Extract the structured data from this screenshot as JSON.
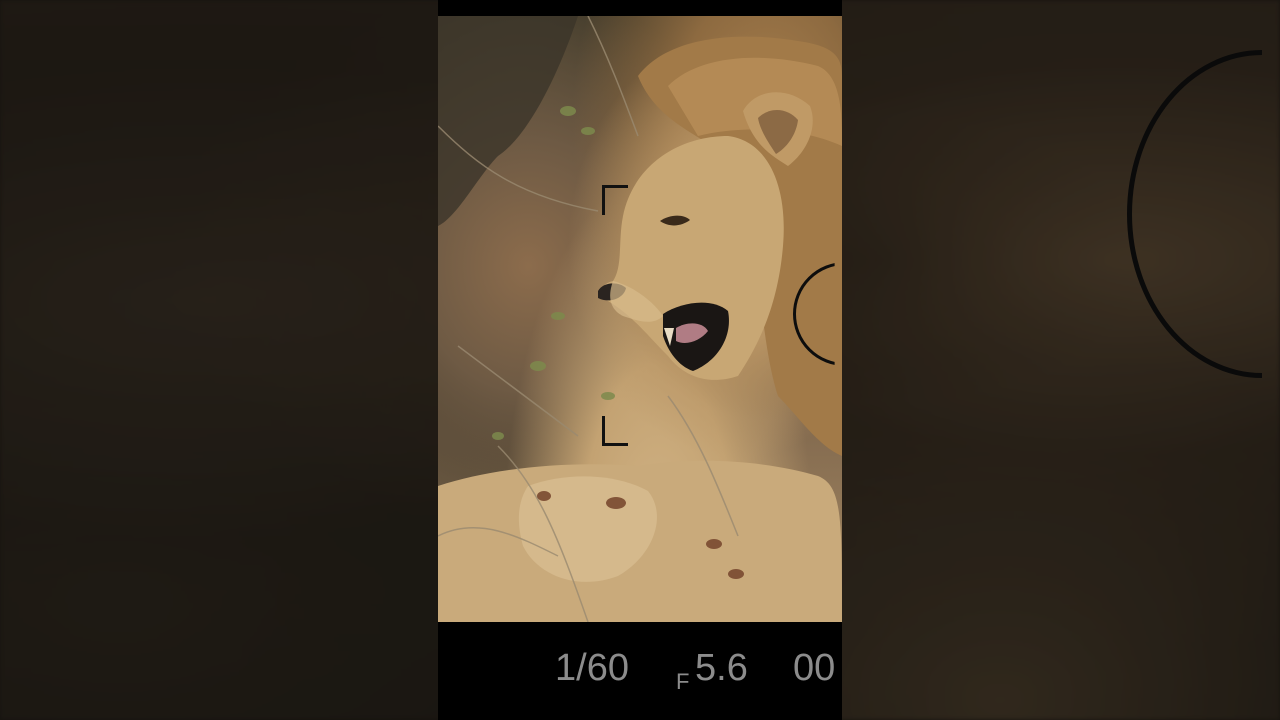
{
  "viewfinder": {
    "shutter_speed": "1/60",
    "aperture_prefix": "F",
    "aperture_value": "5.6",
    "exposure_comp": "00"
  },
  "colors": {
    "readout_text": "#8c8c8c",
    "frame_bg": "#000000"
  },
  "icons": {
    "focus_bracket": "focus-bracket-icon",
    "focus_circle": "focus-circle-icon"
  }
}
